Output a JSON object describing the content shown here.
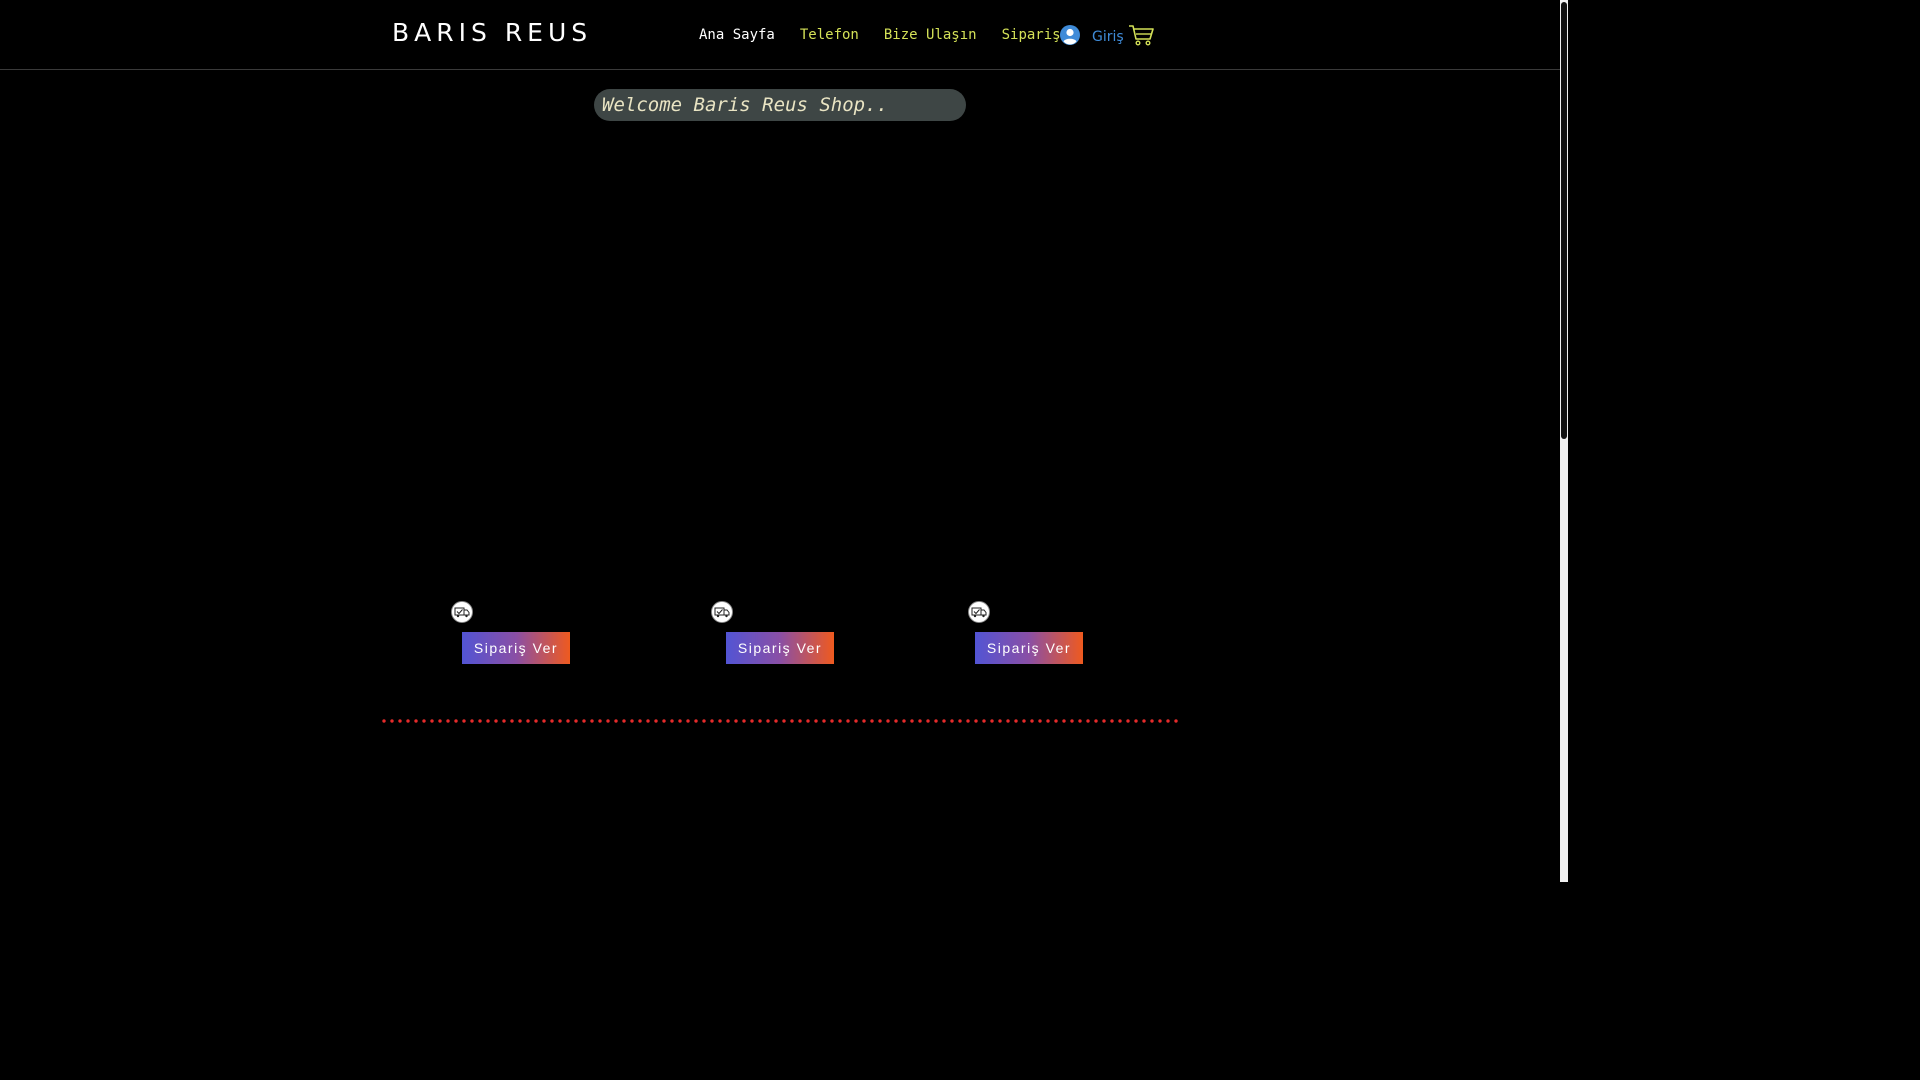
{
  "header": {
    "brand": "BARIS REUS",
    "nav": [
      {
        "label": "Ana Sayfa"
      },
      {
        "label": "Telefon"
      },
      {
        "label": "Bize Ulaşın"
      },
      {
        "label": "Sipariş"
      }
    ],
    "login_label": "Giriş",
    "icons": {
      "user": "user-avatar-icon",
      "cart": "shopping-cart-icon"
    },
    "colors": {
      "nav_active": "#ffffff",
      "nav_inactive": "#d4e157",
      "login": "#3f8bd8"
    }
  },
  "welcome": {
    "text": "Welcome Baris Reus Shop.."
  },
  "products": [
    {
      "icon": "delivery-truck-icon",
      "button_label": "Sipariş Ver"
    },
    {
      "icon": "delivery-truck-icon",
      "button_label": "Sipariş Ver"
    },
    {
      "icon": "delivery-truck-icon",
      "button_label": "Sipariş Ver"
    }
  ],
  "colors": {
    "background": "#000000",
    "button_gradient_start": "#5254d4",
    "button_gradient_end": "#ef5a1f",
    "divider": "#e52b2b"
  }
}
